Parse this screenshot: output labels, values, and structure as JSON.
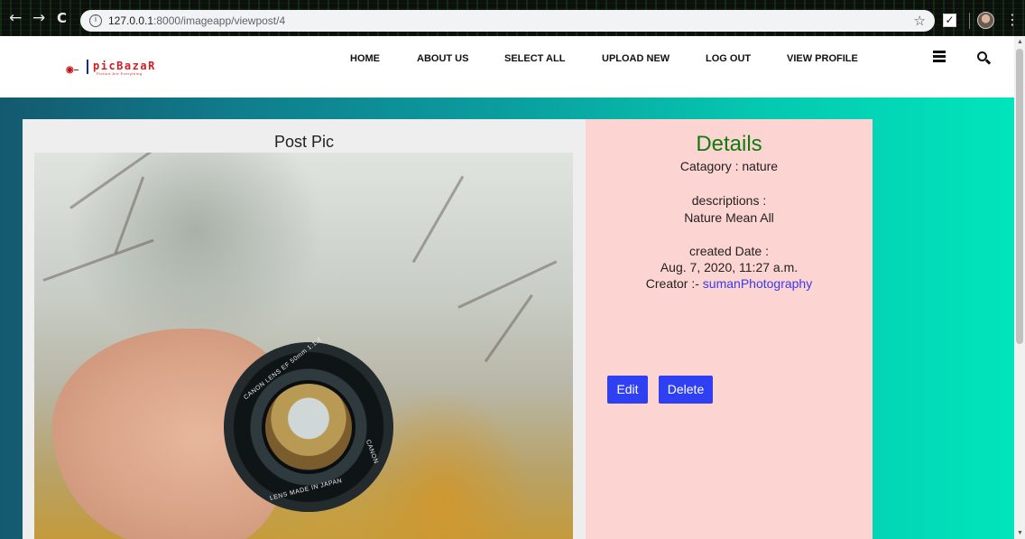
{
  "browser": {
    "url_host": "127.0.0.1",
    "url_rest": ":8000/imageapp/viewpost/4",
    "back_icon": "←",
    "forward_icon": "→",
    "reload_icon": "C",
    "info_icon": "i",
    "star_icon": "☆",
    "ext_icon": "✓",
    "menu_icon": "⋮"
  },
  "header": {
    "logo_brand": "picBazaR",
    "logo_tagline": "Picture Are Everything",
    "nav": [
      "HOME",
      "ABOUT US",
      "SELECT ALL",
      "UPLOAD NEW",
      "LOG OUT",
      "VIEW PROFILE"
    ]
  },
  "post": {
    "title": "Post Pic",
    "lens_text_top": "CANON LENS EF 50mm 1:1.4",
    "lens_text_bottom": "LENS MADE IN JAPAN",
    "lens_text_side": "CANON"
  },
  "details": {
    "heading": "Details",
    "category": "Catagory : nature",
    "descriptions_label": "descriptions :",
    "descriptions_value": "Nature Mean All",
    "created_label": "created Date :",
    "created_value": "Aug. 7, 2020, 11:27 a.m.",
    "creator_label": "Creator :- ",
    "creator_name": "sumanPhotography",
    "edit_label": "Edit",
    "delete_label": "Delete"
  },
  "colors": {
    "details_heading": "#0f7c0f",
    "button_bg": "#2f3ff2",
    "details_bg": "#fcd4d1",
    "link": "#3a3aef"
  }
}
